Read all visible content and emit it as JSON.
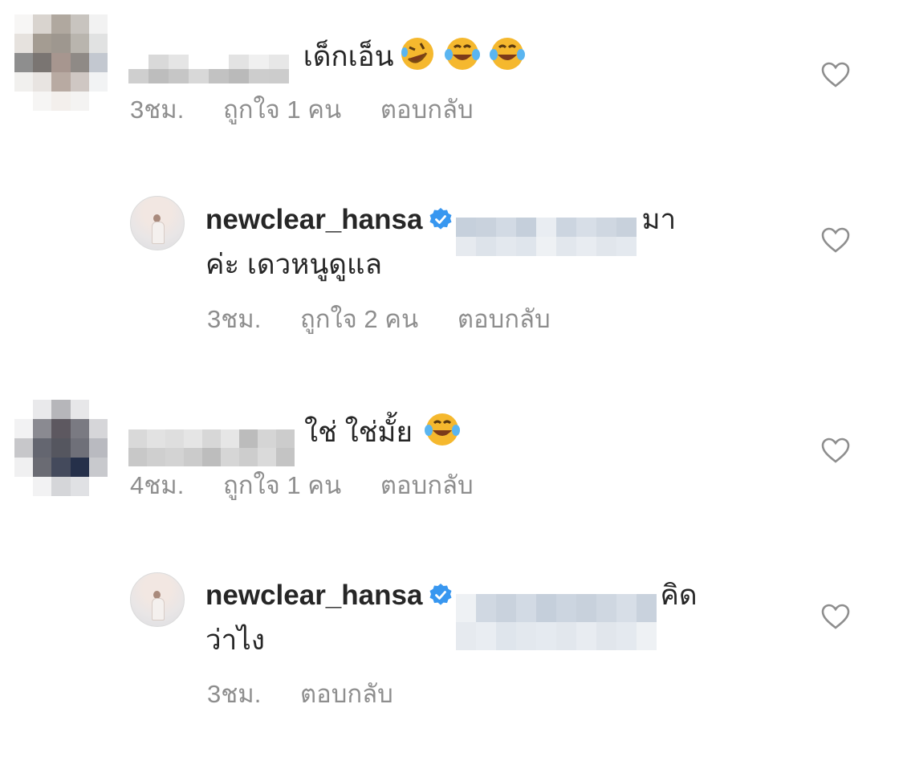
{
  "comments": [
    {
      "text": "เด็กเอ็น",
      "emojis": [
        "rolling-on-floor-laughing",
        "tears-of-joy",
        "tears-of-joy"
      ],
      "time": "3ชม.",
      "likes": "ถูกใจ 1 คน",
      "reply": "ตอบกลับ"
    },
    {
      "username": "newclear_hansa",
      "text_line1_end": "มา",
      "text_line2": "ค่ะ เดวหนูดูแล",
      "time": "3ชม.",
      "likes": "ถูกใจ 2 คน",
      "reply": "ตอบกลับ"
    },
    {
      "text": "ใช่ ใช่มั้ย",
      "emojis": [
        "tears-of-joy"
      ],
      "time": "4ชม.",
      "likes": "ถูกใจ 1 คน",
      "reply": "ตอบกลับ"
    },
    {
      "username": "newclear_hansa",
      "text_line1_end": "คิด",
      "text_line2": "ว่าไง",
      "time": "3ชม.",
      "reply": "ตอบกลับ"
    }
  ],
  "colors": {
    "verified_badge": "#3897f0",
    "meta_text": "#8e8e8e",
    "primary_text": "#262626",
    "heart_outline": "#8e8e8e"
  },
  "icons": {
    "like": "heart-outline-icon",
    "verified": "verified-badge-icon"
  }
}
